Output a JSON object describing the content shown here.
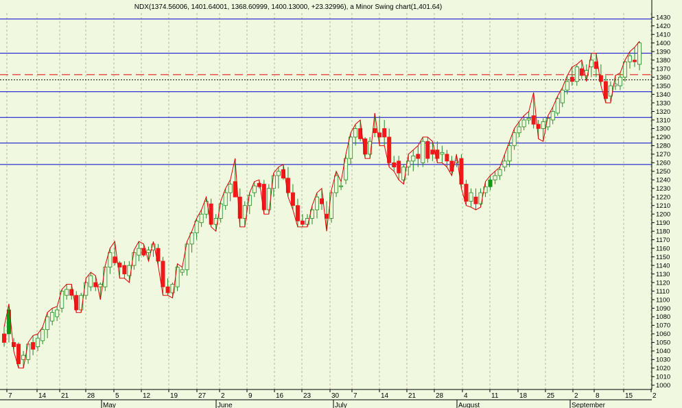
{
  "title": "NDX(1374.56006, 1401.64001, 1368.60999, 1400.13000, +23.32996), a  Minor Swing chart(1,401.64)",
  "chart_data": {
    "type": "candlestick",
    "ylim": [
      995,
      1435
    ],
    "y_ticks": [
      1000,
      1010,
      1020,
      1030,
      1040,
      1050,
      1060,
      1070,
      1080,
      1090,
      1100,
      1110,
      1120,
      1130,
      1140,
      1150,
      1160,
      1170,
      1180,
      1190,
      1200,
      1210,
      1220,
      1230,
      1240,
      1250,
      1260,
      1270,
      1280,
      1290,
      1300,
      1310,
      1320,
      1330,
      1340,
      1350,
      1360,
      1370,
      1380,
      1390,
      1400,
      1410,
      1420,
      1430
    ],
    "x_ticks": [
      "7",
      "14",
      "21",
      "28",
      "5",
      "12",
      "19",
      "27",
      "2",
      "9",
      "16",
      "23",
      "30",
      "7",
      "14",
      "21",
      "28",
      "4",
      "11",
      "18",
      "25",
      "2",
      "8",
      "15",
      "2"
    ],
    "months": [
      "May",
      "June",
      "July",
      "August",
      "September"
    ],
    "colors": {
      "background": "#F0F8E0",
      "grid": "#B8B890",
      "level": "#0000CC",
      "dashed_level": "#E00000",
      "dotted_level": "#000000",
      "swing_line": "#E00000",
      "down_candle": "#F01818",
      "up_candle": "#EAF7D8",
      "candle_outline": "#228822",
      "highlight_up": "#119911"
    },
    "levels": [
      {
        "value": 1428,
        "style": "solid"
      },
      {
        "value": 1388,
        "style": "solid"
      },
      {
        "value": 1363,
        "style": "dashed"
      },
      {
        "value": 1357,
        "style": "dotted"
      },
      {
        "value": 1343,
        "style": "solid"
      },
      {
        "value": 1313,
        "style": "solid"
      },
      {
        "value": 1283,
        "style": "solid"
      },
      {
        "value": 1258,
        "style": "solid"
      }
    ],
    "candles": [
      [
        1060,
        1068,
        1045,
        1050
      ],
      [
        1060,
        1095,
        1050,
        1088
      ],
      [
        1050,
        1055,
        1040,
        1045
      ],
      [
        1048,
        1050,
        1020,
        1025
      ],
      [
        1030,
        1040,
        1020,
        1035
      ],
      [
        1030,
        1050,
        1025,
        1048
      ],
      [
        1050,
        1058,
        1035,
        1042
      ],
      [
        1045,
        1060,
        1040,
        1055
      ],
      [
        1052,
        1068,
        1048,
        1065
      ],
      [
        1065,
        1085,
        1055,
        1080
      ],
      [
        1075,
        1090,
        1070,
        1085
      ],
      [
        1080,
        1092,
        1075,
        1088
      ],
      [
        1090,
        1112,
        1085,
        1110
      ],
      [
        1105,
        1118,
        1100,
        1112
      ],
      [
        1112,
        1118,
        1100,
        1105
      ],
      [
        1105,
        1110,
        1085,
        1088
      ],
      [
        1088,
        1108,
        1085,
        1105
      ],
      [
        1105,
        1125,
        1100,
        1120
      ],
      [
        1115,
        1132,
        1110,
        1128
      ],
      [
        1120,
        1128,
        1110,
        1115
      ],
      [
        1115,
        1120,
        1100,
        1118
      ],
      [
        1115,
        1140,
        1110,
        1138
      ],
      [
        1138,
        1160,
        1130,
        1155
      ],
      [
        1150,
        1168,
        1140,
        1143
      ],
      [
        1143,
        1145,
        1125,
        1138
      ],
      [
        1140,
        1145,
        1125,
        1130
      ],
      [
        1128,
        1145,
        1120,
        1140
      ],
      [
        1140,
        1158,
        1135,
        1155
      ],
      [
        1152,
        1168,
        1145,
        1160
      ],
      [
        1160,
        1165,
        1150,
        1152
      ],
      [
        1155,
        1162,
        1145,
        1158
      ],
      [
        1158,
        1168,
        1150,
        1165
      ],
      [
        1160,
        1165,
        1140,
        1145
      ],
      [
        1145,
        1150,
        1105,
        1115
      ],
      [
        1115,
        1125,
        1105,
        1108
      ],
      [
        1108,
        1120,
        1102,
        1118
      ],
      [
        1115,
        1142,
        1110,
        1138
      ],
      [
        1132,
        1138,
        1128,
        1135
      ],
      [
        1135,
        1168,
        1128,
        1165
      ],
      [
        1165,
        1180,
        1155,
        1178
      ],
      [
        1178,
        1195,
        1170,
        1192
      ],
      [
        1190,
        1205,
        1185,
        1200
      ],
      [
        1200,
        1220,
        1195,
        1215
      ],
      [
        1212,
        1218,
        1185,
        1188
      ],
      [
        1188,
        1200,
        1180,
        1195
      ],
      [
        1195,
        1215,
        1190,
        1212
      ],
      [
        1210,
        1230,
        1205,
        1225
      ],
      [
        1225,
        1240,
        1215,
        1235
      ],
      [
        1238,
        1265,
        1228,
        1220
      ],
      [
        1220,
        1230,
        1185,
        1195
      ],
      [
        1195,
        1215,
        1185,
        1210
      ],
      [
        1210,
        1225,
        1200,
        1222
      ],
      [
        1225,
        1238,
        1220,
        1233
      ],
      [
        1236,
        1240,
        1230,
        1232
      ],
      [
        1235,
        1240,
        1200,
        1205
      ],
      [
        1205,
        1235,
        1200,
        1230
      ],
      [
        1230,
        1248,
        1220,
        1245
      ],
      [
        1245,
        1255,
        1230,
        1250
      ],
      [
        1252,
        1258,
        1240,
        1242
      ],
      [
        1242,
        1255,
        1220,
        1225
      ],
      [
        1225,
        1235,
        1205,
        1210
      ],
      [
        1210,
        1218,
        1185,
        1192
      ],
      [
        1192,
        1200,
        1185,
        1188
      ],
      [
        1188,
        1200,
        1185,
        1195
      ],
      [
        1195,
        1210,
        1188,
        1205
      ],
      [
        1205,
        1225,
        1195,
        1220
      ],
      [
        1218,
        1230,
        1205,
        1212
      ],
      [
        1200,
        1215,
        1180,
        1195
      ],
      [
        1195,
        1228,
        1190,
        1225
      ],
      [
        1225,
        1250,
        1220,
        1245
      ],
      [
        1232,
        1238,
        1228,
        1233
      ],
      [
        1240,
        1270,
        1235,
        1265
      ],
      [
        1265,
        1295,
        1258,
        1290
      ],
      [
        1290,
        1305,
        1280,
        1300
      ],
      [
        1300,
        1310,
        1285,
        1288
      ],
      [
        1288,
        1290,
        1265,
        1270
      ],
      [
        1270,
        1290,
        1265,
        1285
      ],
      [
        1300,
        1318,
        1290,
        1295
      ],
      [
        1295,
        1315,
        1280,
        1290
      ],
      [
        1300,
        1310,
        1280,
        1290
      ],
      [
        1290,
        1300,
        1255,
        1260
      ],
      [
        1260,
        1268,
        1250,
        1255
      ],
      [
        1262,
        1268,
        1240,
        1248
      ],
      [
        1240,
        1258,
        1235,
        1255
      ],
      [
        1255,
        1270,
        1245,
        1262
      ],
      [
        1262,
        1275,
        1250,
        1268
      ],
      [
        1270,
        1280,
        1255,
        1265
      ],
      [
        1260,
        1290,
        1255,
        1285
      ],
      [
        1285,
        1290,
        1260,
        1265
      ],
      [
        1275,
        1285,
        1262,
        1270
      ],
      [
        1275,
        1285,
        1260,
        1265
      ],
      [
        1270,
        1280,
        1260,
        1272
      ],
      [
        1270,
        1275,
        1255,
        1262
      ],
      [
        1262,
        1268,
        1245,
        1250
      ],
      [
        1260,
        1270,
        1255,
        1262
      ],
      [
        1265,
        1270,
        1230,
        1235
      ],
      [
        1235,
        1240,
        1210,
        1215
      ],
      [
        1215,
        1230,
        1208,
        1225
      ],
      [
        1220,
        1230,
        1205,
        1212
      ],
      [
        1212,
        1230,
        1208,
        1225
      ],
      [
        1225,
        1238,
        1220,
        1232
      ],
      [
        1232,
        1245,
        1228,
        1240
      ],
      [
        1240,
        1250,
        1235,
        1245
      ],
      [
        1245,
        1255,
        1240,
        1252
      ],
      [
        1255,
        1270,
        1250,
        1262
      ],
      [
        1262,
        1285,
        1255,
        1280
      ],
      [
        1280,
        1300,
        1275,
        1295
      ],
      [
        1295,
        1308,
        1290,
        1302
      ],
      [
        1302,
        1315,
        1298,
        1310
      ],
      [
        1310,
        1320,
        1305,
        1312
      ],
      [
        1315,
        1342,
        1300,
        1305
      ],
      [
        1305,
        1310,
        1288,
        1300
      ],
      [
        1300,
        1312,
        1285,
        1308
      ],
      [
        1302,
        1315,
        1298,
        1312
      ],
      [
        1310,
        1325,
        1305,
        1320
      ],
      [
        1318,
        1338,
        1315,
        1335
      ],
      [
        1330,
        1348,
        1325,
        1345
      ],
      [
        1345,
        1362,
        1340,
        1355
      ],
      [
        1360,
        1372,
        1350,
        1355
      ],
      [
        1355,
        1375,
        1350,
        1372
      ],
      [
        1370,
        1380,
        1358,
        1362
      ],
      [
        1362,
        1375,
        1355,
        1368
      ],
      [
        1372,
        1388,
        1360,
        1380
      ],
      [
        1378,
        1388,
        1360,
        1370
      ],
      [
        1362,
        1375,
        1350,
        1355
      ],
      [
        1355,
        1362,
        1330,
        1335
      ],
      [
        1338,
        1355,
        1330,
        1350
      ],
      [
        1350,
        1362,
        1345,
        1352
      ],
      [
        1350,
        1365,
        1345,
        1360
      ],
      [
        1360,
        1380,
        1355,
        1378
      ],
      [
        1378,
        1390,
        1370,
        1385
      ],
      [
        1380,
        1395,
        1372,
        1378
      ],
      [
        1375,
        1402,
        1368,
        1400
      ]
    ]
  }
}
